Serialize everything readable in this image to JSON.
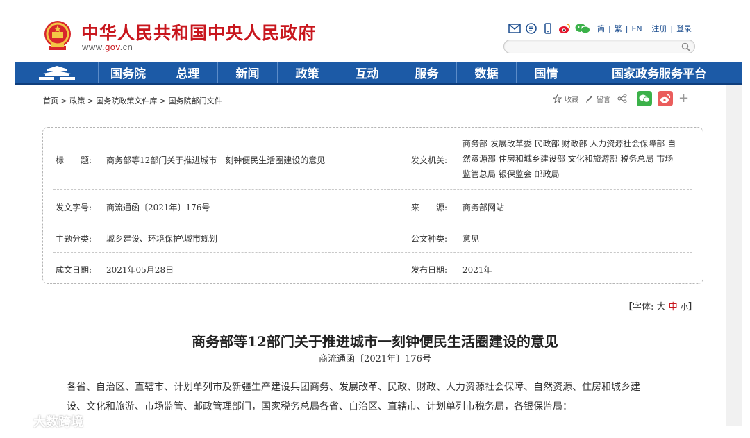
{
  "header": {
    "site_title": "中华人民共和国中央人民政府",
    "site_url_prefix": "www.",
    "site_url_mid": "gov",
    "site_url_suffix": ".cn",
    "lang_links": [
      "简",
      "繁",
      "EN",
      "注册",
      "登录"
    ]
  },
  "nav": {
    "items": [
      "国务院",
      "总理",
      "新闻",
      "政策",
      "互动",
      "服务",
      "数据",
      "国情",
      "国家政务服务平台"
    ]
  },
  "breadcrumb": "首页 > 政策 > 国务院政策文件库 > 国务院部门文件",
  "share": {
    "collect": "收藏",
    "comment": "留言",
    "plus": "+"
  },
  "info": {
    "title_label": "标　　题:",
    "title_value": "商务部等12部门关于推进城市一刻钟便民生活圈建设的意见",
    "issuer_label": "发文机关:",
    "issuer_lines": [
      "商务部 发展改革委 民政部 财政部 人力资源社会保障部 自",
      "然资源部 住房和城乡建设部 文化和旅游部 税务总局 市场",
      "监管总局 银保监会 邮政局"
    ],
    "doc_no_label": "发文字号:",
    "doc_no_value": "商流通函〔2021年〕176号",
    "source_label": "来　　源:",
    "source_value": "商务部网站",
    "topic_label": "主题分类:",
    "topic_value": "城乡建设、环境保护\\城市规划",
    "type_label": "公文种类:",
    "type_value": "意见",
    "created_label": "成文日期:",
    "created_value": "2021年05月28日",
    "published_label": "发布日期:",
    "published_value": "2021年"
  },
  "font_ctrl": {
    "prefix": "【字体:",
    "large": "大",
    "medium": "中",
    "small": "小",
    "suffix": "】"
  },
  "article": {
    "title": "商务部等12部门关于推进城市一刻钟便民生活圈建设的意见",
    "doc_no": "商流通函〔2021年〕176号",
    "body_line1": "各省、自治区、直辖市、计划单列市及新疆生产建设兵团商务、发展改革、民政、财政、人力资源社会保障、自然资源、住房和城乡建",
    "body_line2": "设、文化和旅游、市场监管、邮政管理部门，国家税务总局各省、自治区、直辖市、计划单列市税务局，各银保监局："
  },
  "watermark": "大数跨境",
  "colors": {
    "brand_red": "#c8161d",
    "nav_blue": "#1c5aa6",
    "link_blue": "#1a4c8e"
  }
}
